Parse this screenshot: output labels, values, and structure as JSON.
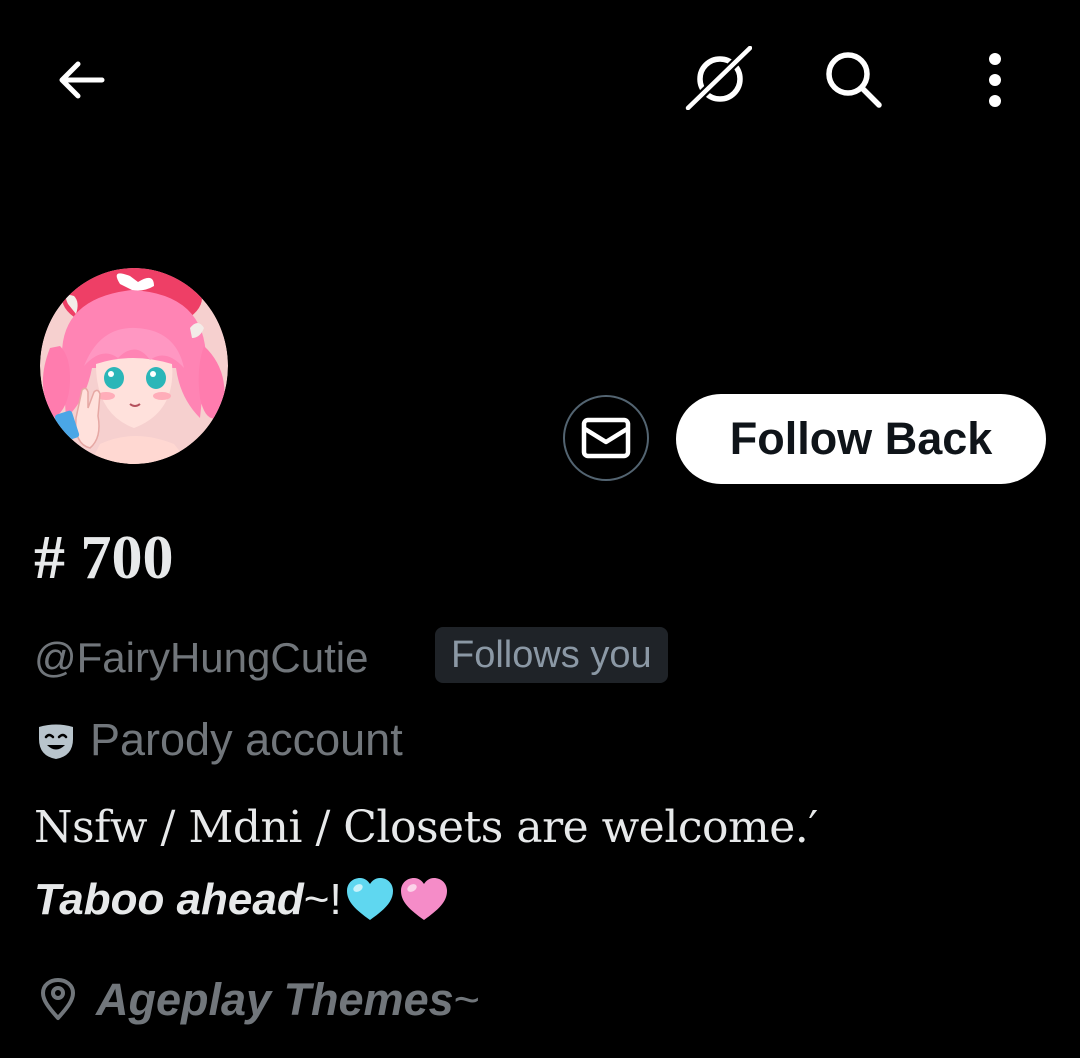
{
  "header": {
    "back_icon": "arrow-left-icon",
    "grok_icon": "grok-icon",
    "search_icon": "search-icon",
    "more_icon": "more-vertical-icon"
  },
  "profile": {
    "avatar_icon": "anime-avatar",
    "message_icon": "envelope-icon",
    "follow_label": "Follow Back",
    "display_name": "# 700",
    "handle": "@FairyHungCutie",
    "follows_badge": "Follows you",
    "parody_icon": "mask-icon",
    "parody_label": "Parody account",
    "bio_line1": "Nsfw / Mdni / Closets are welcome.′",
    "bio_line2_bold": "Taboo ahead",
    "bio_line2_tail": "~!",
    "bio_hearts": [
      "light-blue-heart",
      "pink-heart"
    ],
    "location_icon": "location-pin-icon",
    "location_bold": "Ageplay Themes",
    "location_tail": "~"
  },
  "colors": {
    "background": "#000000",
    "primary_text": "#e7e9ea",
    "secondary_text": "#71767b",
    "button_bg": "#ffffff",
    "button_text": "#0f1419",
    "badge_bg": "#1f2328",
    "heart_blue": "#5fd7f0",
    "heart_pink": "#f58cc8"
  }
}
